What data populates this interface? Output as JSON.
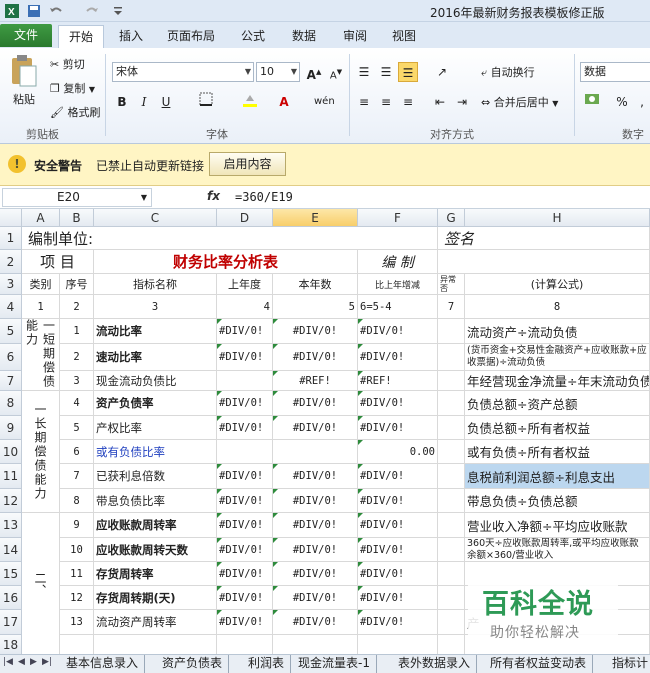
{
  "window": {
    "title": "2016年最新财务报表模板修正版"
  },
  "ribbon": {
    "tabs": [
      "文件",
      "开始",
      "插入",
      "页面布局",
      "公式",
      "数据",
      "审阅",
      "视图"
    ],
    "clipboard": {
      "paste": "粘贴",
      "cut": "剪切",
      "copy": "复制",
      "format_painter": "格式刷",
      "label": "剪贴板"
    },
    "font": {
      "name": "宋体",
      "size": "10",
      "label": "字体",
      "bold": "B",
      "italic": "I",
      "underline": "U"
    },
    "alignment": {
      "wrap": "自动换行",
      "merge": "合并后居中",
      "label": "对齐方式"
    },
    "number": {
      "format": "数据",
      "label": "数字"
    }
  },
  "security": {
    "title": "安全警告",
    "message": "已禁止自动更新链接",
    "button": "启用内容"
  },
  "formula_bar": {
    "name_box": "E20",
    "fx": "fx",
    "formula": "=360/E19"
  },
  "columns": [
    "A",
    "B",
    "C",
    "D",
    "E",
    "F",
    "G",
    "H"
  ],
  "rows": [
    "1",
    "2",
    "3",
    "4",
    "5",
    "6",
    "7",
    "8",
    "9",
    "10",
    "11",
    "12",
    "13",
    "14",
    "15",
    "16",
    "17",
    "18"
  ],
  "sheet": {
    "r1": {
      "a": "编制单位:",
      "g": "签名"
    },
    "r2": {
      "a": "项  目",
      "c": "财务比率分析表",
      "f": "编 制"
    },
    "r3": {
      "a": "类别",
      "b": "序号",
      "c": "指标名称",
      "d": "上年度",
      "e": "本年数",
      "f": "比上年增减",
      "g": "异常否",
      "h": "(计算公式)"
    },
    "r4": {
      "a": "1",
      "b": "2",
      "c": "3",
      "d": "4",
      "e": "5",
      "f": "6=5-4",
      "g": "7",
      "h": "8"
    },
    "group1": "一短期偿债能力",
    "group2": "一长期偿债能力",
    "group3": "二、",
    "data": [
      {
        "b": "1",
        "c": "流动比率",
        "bold": true,
        "d": "#DIV/0!",
        "e": "#DIV/0!",
        "f": "#DIV/0!",
        "h": "流动资产÷流动负债"
      },
      {
        "b": "2",
        "c": "速动比率",
        "bold": true,
        "d": "#DIV/0!",
        "e": "#DIV/0!",
        "f": "#DIV/0!",
        "h": "(货币资金+交易性金融资产+应收账款+应收票据)÷流动负债"
      },
      {
        "b": "3",
        "c": "现金流动负债比",
        "bold": false,
        "d": "",
        "e": "#REF!",
        "f": "#REF!",
        "h": "年经营现金净流量÷年末流动负债"
      },
      {
        "b": "4",
        "c": "资产负债率",
        "bold": true,
        "d": "#DIV/0!",
        "e": "#DIV/0!",
        "f": "#DIV/0!",
        "h": "负债总额÷资产总额"
      },
      {
        "b": "5",
        "c": "产权比率",
        "bold": false,
        "d": "#DIV/0!",
        "e": "#DIV/0!",
        "f": "#DIV/0!",
        "h": "负债总额÷所有者权益"
      },
      {
        "b": "6",
        "c": "或有负债比率",
        "bold": false,
        "blue": true,
        "d": "",
        "e": "",
        "f": "0.00",
        "h": "或有负债÷所有者权益"
      },
      {
        "b": "7",
        "c": "已获利息倍数",
        "bold": false,
        "d": "#DIV/0!",
        "e": "#DIV/0!",
        "f": "#DIV/0!",
        "h": "息税前利润总额÷利息支出"
      },
      {
        "b": "8",
        "c": "带息负债比率",
        "bold": false,
        "d": "#DIV/0!",
        "e": "#DIV/0!",
        "f": "#DIV/0!",
        "h": "带息负债÷负债总额"
      },
      {
        "b": "9",
        "c": "应收账款周转率",
        "bold": true,
        "d": "#DIV/0!",
        "e": "#DIV/0!",
        "f": "#DIV/0!",
        "h": "营业收入净额÷平均应收账款"
      },
      {
        "b": "10",
        "c": "应收账款周转天数",
        "bold": true,
        "d": "#DIV/0!",
        "e": "#DIV/0!",
        "f": "#DIV/0!",
        "h": "360天÷应收账款周转率,或平均应收账款余额×360/营业收入"
      },
      {
        "b": "11",
        "c": "存货周转率",
        "bold": true,
        "d": "#DIV/0!",
        "e": "#DIV/0!",
        "f": "#DIV/0!",
        "h": ""
      },
      {
        "b": "12",
        "c": "存货周转期(天)",
        "bold": true,
        "d": "#DIV/0!",
        "e": "#DIV/0!",
        "f": "#DIV/0!",
        "h": ""
      },
      {
        "b": "13",
        "c": "流动资产周转率",
        "bold": false,
        "d": "#DIV/0!",
        "e": "#DIV/0!",
        "f": "#DIV/0!",
        "h": "产"
      },
      {
        "b": "",
        "c": "",
        "bold": false,
        "d": "",
        "e": "",
        "f": "",
        "h": ""
      }
    ]
  },
  "sheet_tabs": [
    "基本信息录入",
    "资产负债表",
    "利润表",
    "现金流量表-1",
    "表外数据录入",
    "所有者权益变动表",
    "指标计"
  ],
  "watermark": {
    "title": "百科全说",
    "subtitle": "助你轻松解决"
  }
}
